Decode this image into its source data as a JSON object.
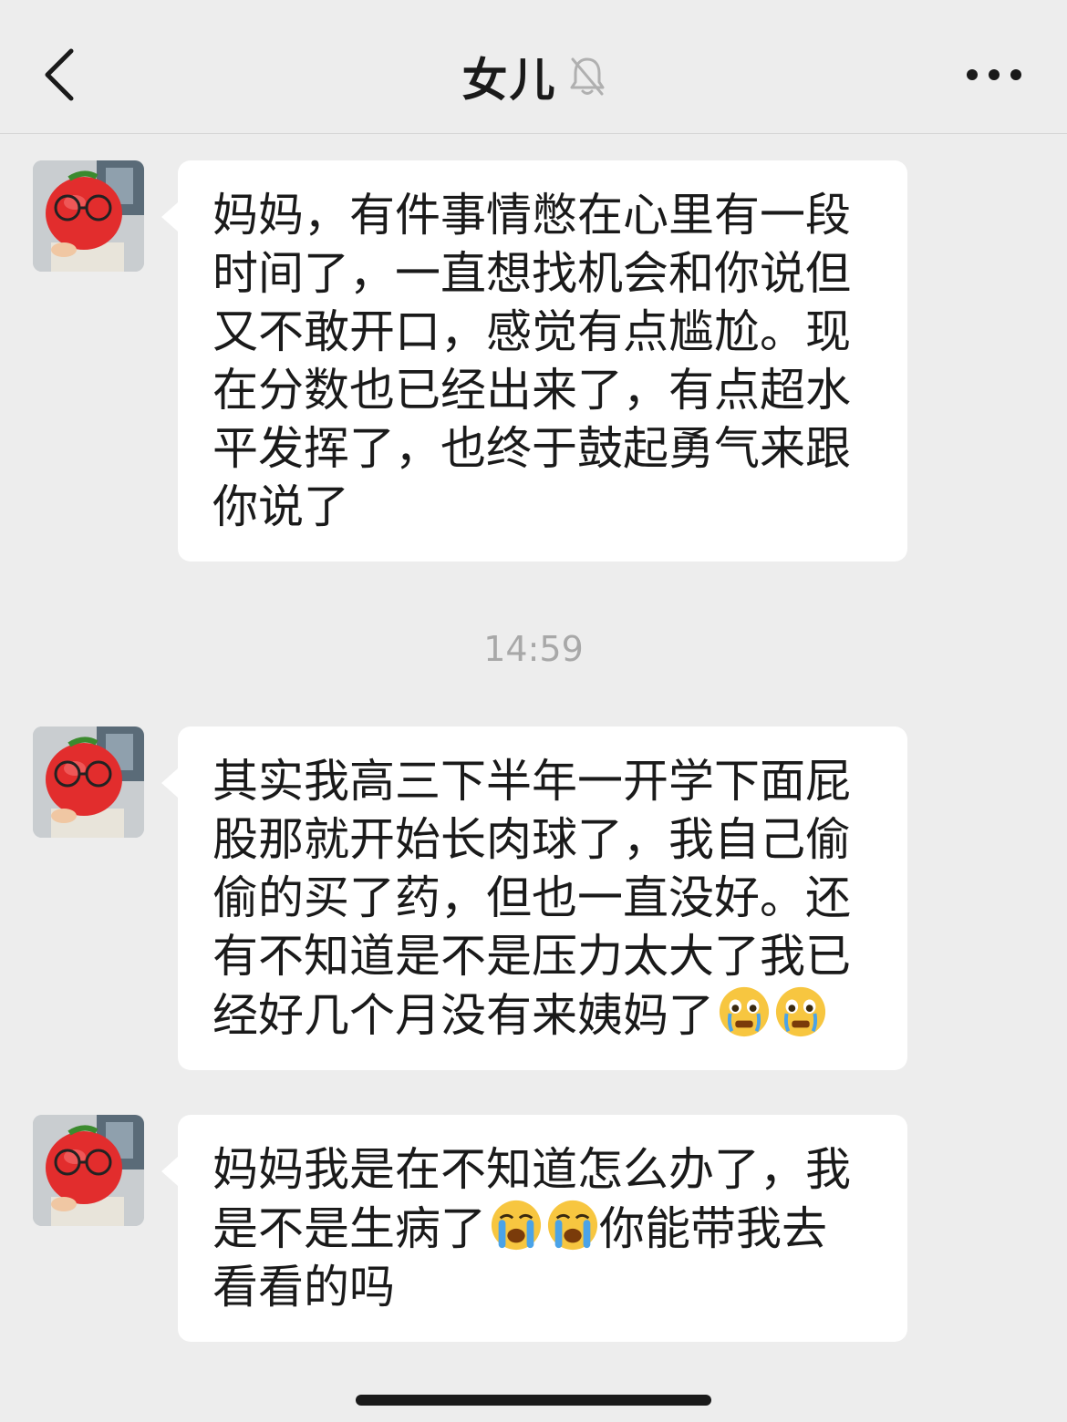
{
  "header": {
    "title": "女儿",
    "back_icon": "chevron-left-icon",
    "mute_icon": "bell-muted-icon",
    "more_icon": "more-dots-icon"
  },
  "messages": [
    {
      "lines": [
        "妈妈，有件事情憋在心里有一段",
        "时间了，一直想找机会和你说但",
        "又不敢开口，感觉有点尴尬。现",
        "在分数也已经出来了，有点超水",
        "平发挥了，也终于鼓起勇气来跟",
        "你说了"
      ]
    },
    {
      "lines": [
        "其实我高三下半年一开学下面屁",
        "股那就开始长肉球了，我自己偷",
        "偷的买了药，但也一直没好。还",
        "有不知道是不是压力太大了我已",
        "经好几个月没有来姨妈了"
      ],
      "emojis": [
        "crying-face-emoji",
        "crying-face-emoji"
      ]
    },
    {
      "lines": [
        "妈妈我是在不知道怎么办了，我",
        "是不是生病了",
        "你能带我去",
        "看看的吗"
      ],
      "emojis": [
        "loudly-crying-face-emoji",
        "loudly-crying-face-emoji"
      ]
    }
  ],
  "timestamp": "14:59",
  "colors": {
    "background": "#ededed",
    "bubble": "#ffffff",
    "text": "#1a1a1a",
    "timestamp": "#a8a8a8"
  }
}
